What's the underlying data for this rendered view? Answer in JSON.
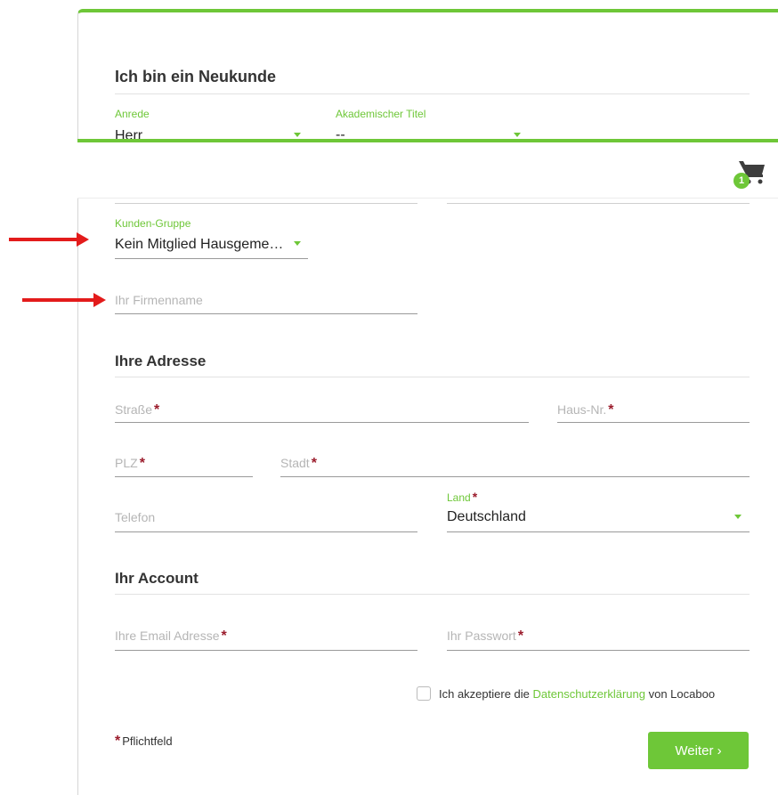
{
  "new_customer": {
    "heading": "Ich bin ein Neukunde",
    "salutation": {
      "label": "Anrede",
      "value": "Herr"
    },
    "academic_title": {
      "label": "Akademischer Titel",
      "value": "--"
    }
  },
  "cart": {
    "count": "1",
    "icon": "cart-icon"
  },
  "customer_group": {
    "label": "Kunden-Gruppe",
    "value": "Kein Mitglied Hausgeme…"
  },
  "company": {
    "placeholder": "Ihr Firmenname"
  },
  "address": {
    "heading": "Ihre Adresse",
    "street": {
      "placeholder": "Straße",
      "required": "*"
    },
    "house_no": {
      "placeholder": "Haus-Nr.",
      "required": "*"
    },
    "zip": {
      "placeholder": "PLZ",
      "required": "*"
    },
    "city": {
      "placeholder": "Stadt",
      "required": "*"
    },
    "phone": {
      "placeholder": "Telefon"
    },
    "country": {
      "label": "Land",
      "required": "*",
      "value": "Deutschland"
    }
  },
  "account": {
    "heading": "Ihr Account",
    "email": {
      "placeholder": "Ihre Email Adresse",
      "required": "*"
    },
    "password": {
      "placeholder": "Ihr Passwort",
      "required": "*"
    }
  },
  "consent": {
    "prefix": "Ich akzeptiere die ",
    "link": "Datenschutzerklärung",
    "suffix": " von Locaboo"
  },
  "footer": {
    "required_star": "*",
    "required_note": "Pflichtfeld",
    "next_button": "Weiter ›"
  },
  "colors": {
    "accent": "#6ec738",
    "required": "#9b1c2c",
    "annotation": "#e31b1b"
  }
}
